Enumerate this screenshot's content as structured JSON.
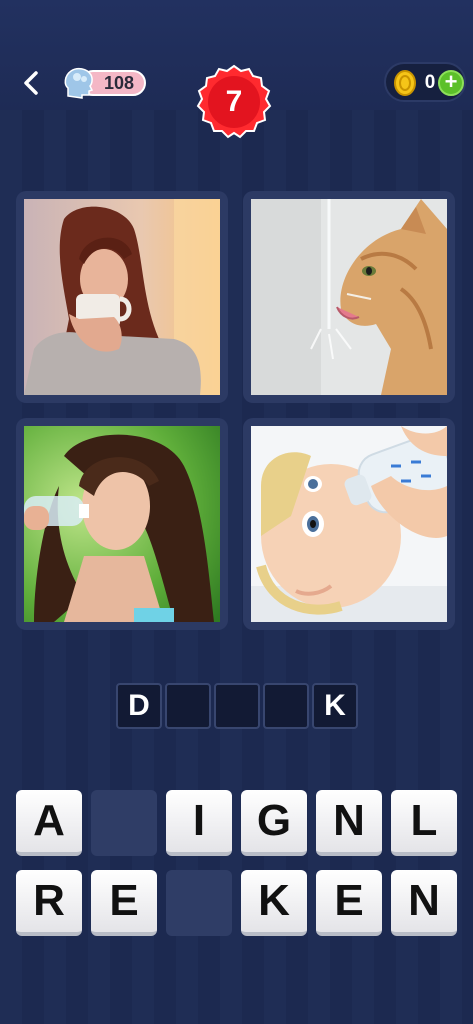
{
  "header": {
    "hints_count": "108",
    "level": "7",
    "coins": "0",
    "plus_label": "+"
  },
  "photos": [
    {
      "subject": "woman drinking from a mug"
    },
    {
      "subject": "cat drinking from a faucet"
    },
    {
      "subject": "woman drinking from a water bottle"
    },
    {
      "subject": "baby drinking from a bottle"
    }
  ],
  "answer_slots": [
    "D",
    "",
    "",
    "",
    "K"
  ],
  "letter_tiles": [
    [
      "A",
      "",
      "I",
      "G",
      "N",
      "L"
    ],
    [
      "R",
      "E",
      "",
      "K",
      "E",
      "N"
    ]
  ],
  "colors": {
    "background": "#1f2c52",
    "badge_red": "#e3141f",
    "tile_white": "#ffffff",
    "coin_gold": "#f5c518",
    "plus_green": "#5cc02a"
  }
}
